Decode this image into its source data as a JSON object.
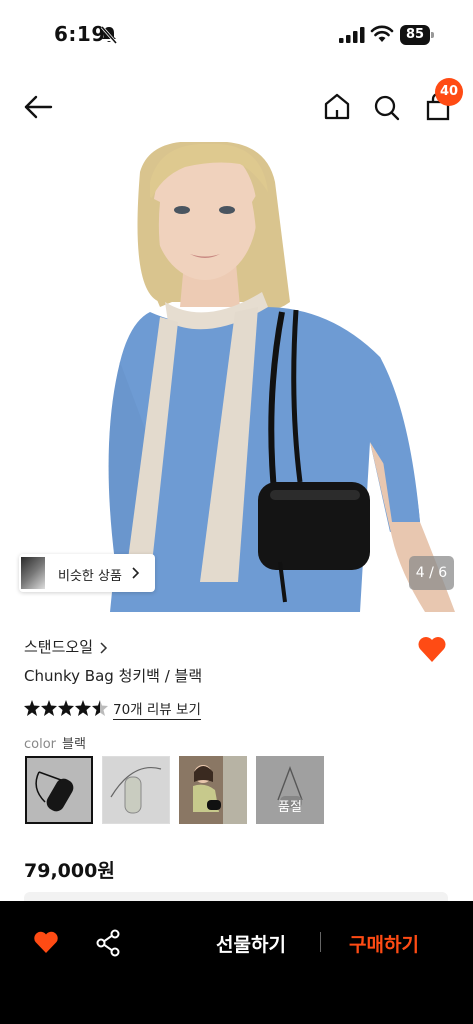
{
  "status_bar": {
    "time": "6:19",
    "battery": "85"
  },
  "header": {
    "cart_count": "40"
  },
  "hero": {
    "similar_label": "비슷한 상품",
    "pager": "4 / 6"
  },
  "product": {
    "brand": "스탠드오일",
    "title": "Chunky Bag 청키백 / 블랙",
    "rating": 4.5,
    "review_link": "70개 리뷰 보기",
    "color_label": "color",
    "color_value": "블랙",
    "swatches": [
      {
        "name": "black-bag",
        "selected": true
      },
      {
        "name": "bluegreen-bag",
        "selected": false
      },
      {
        "name": "model-photo",
        "selected": false
      },
      {
        "name": "gray-bag",
        "selected": false,
        "sold_out_label": "품절"
      }
    ],
    "price": "79,000원"
  },
  "bottom_bar": {
    "gift_label": "선물하기",
    "buy_label": "구매하기"
  },
  "colors": {
    "accent": "#ff4b14",
    "bottom_bar_bg": "#000000",
    "sweater": "#6e9bd3"
  }
}
